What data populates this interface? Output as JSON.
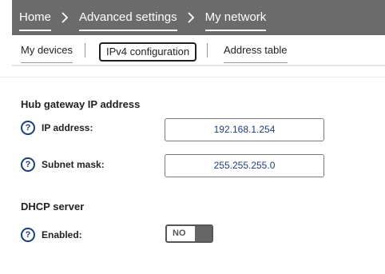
{
  "breadcrumb": {
    "items": [
      {
        "label": "Home"
      },
      {
        "label": "Advanced settings"
      },
      {
        "label": "My network"
      }
    ]
  },
  "tabs": [
    {
      "label": "My devices"
    },
    {
      "label": "IPv4 configuration",
      "active": true
    },
    {
      "label": "Address table"
    }
  ],
  "hub_gateway": {
    "title": "Hub gateway IP address",
    "ip_label": "IP address:",
    "ip_value": "192.168.1.254",
    "subnet_label": "Subnet mask:",
    "subnet_value": "255.255.255.0"
  },
  "dhcp": {
    "title": "DHCP server",
    "enabled_label": "Enabled:",
    "toggle_state": "NO",
    "enabled": false
  },
  "help_icon_glyph": "?",
  "icons": {
    "help": "help-icon",
    "breadcrumb_separator": "chevron-right-icon"
  },
  "colors": {
    "header_bg": "#6b6b6b",
    "field_text": "#1f3f77",
    "help_icon": "#1c3f7a",
    "toggle_knob": "#666666"
  }
}
